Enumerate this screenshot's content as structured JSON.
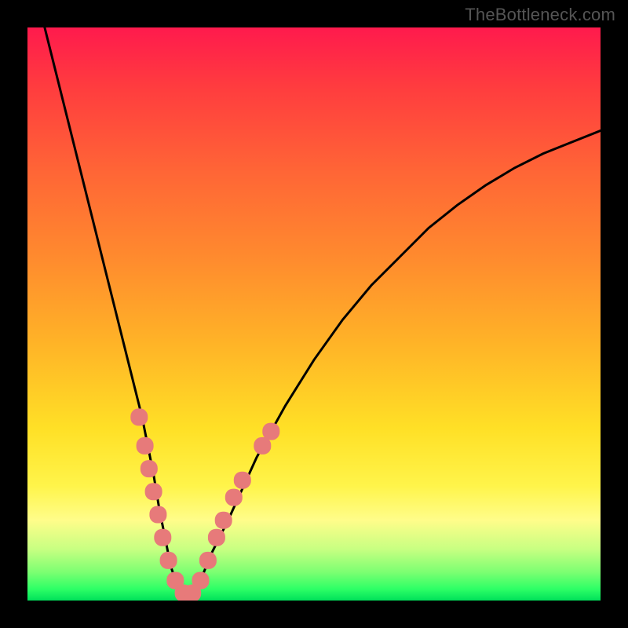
{
  "watermark": {
    "text": "TheBottleneck.com",
    "color": "#555555"
  },
  "colors": {
    "frame": "#000000",
    "curve": "#000000",
    "marker_fill": "#e77a7a",
    "marker_stroke": "#c25858",
    "gradient_stops": [
      "#ff1a4d",
      "#ff3b3f",
      "#ff6536",
      "#ff8a2e",
      "#ffb327",
      "#ffe026",
      "#fff44a",
      "#fffd8a",
      "#c8ff82",
      "#7dff72",
      "#2dff66",
      "#00e05a"
    ]
  },
  "chart_data": {
    "type": "line",
    "title": "",
    "xlabel": "",
    "ylabel": "",
    "xlim": [
      0,
      100
    ],
    "ylim": [
      0,
      100
    ],
    "legend": false,
    "grid": false,
    "series": [
      {
        "name": "bottleneck-curve",
        "x": [
          3,
          5,
          8,
          10,
          12,
          14,
          16,
          18,
          20,
          22,
          23,
          24,
          25,
          26,
          27,
          28,
          29,
          30,
          32,
          35,
          40,
          45,
          50,
          55,
          60,
          65,
          70,
          75,
          80,
          85,
          90,
          95,
          100
        ],
        "y": [
          100,
          92,
          80,
          72,
          64,
          56,
          48,
          40,
          32,
          22,
          16,
          11,
          6,
          3,
          1,
          0.5,
          1,
          3,
          8,
          14,
          25,
          34,
          42,
          49,
          55,
          60,
          65,
          69,
          72.5,
          75.5,
          78,
          80,
          82
        ]
      }
    ],
    "markers": [
      {
        "name": "highlighted-points",
        "shape": "rounded-rect",
        "points": [
          {
            "x": 19.5,
            "y": 32
          },
          {
            "x": 20.5,
            "y": 27
          },
          {
            "x": 21.2,
            "y": 23
          },
          {
            "x": 22.0,
            "y": 19
          },
          {
            "x": 22.8,
            "y": 15
          },
          {
            "x": 23.6,
            "y": 11
          },
          {
            "x": 24.6,
            "y": 7
          },
          {
            "x": 25.8,
            "y": 3.5
          },
          {
            "x": 27.2,
            "y": 1.3
          },
          {
            "x": 28.8,
            "y": 1.3
          },
          {
            "x": 30.2,
            "y": 3.5
          },
          {
            "x": 31.5,
            "y": 7
          },
          {
            "x": 33.0,
            "y": 11
          },
          {
            "x": 34.2,
            "y": 14
          },
          {
            "x": 36.0,
            "y": 18
          },
          {
            "x": 37.5,
            "y": 21
          },
          {
            "x": 41.0,
            "y": 27
          },
          {
            "x": 42.5,
            "y": 29.5
          }
        ]
      }
    ]
  }
}
